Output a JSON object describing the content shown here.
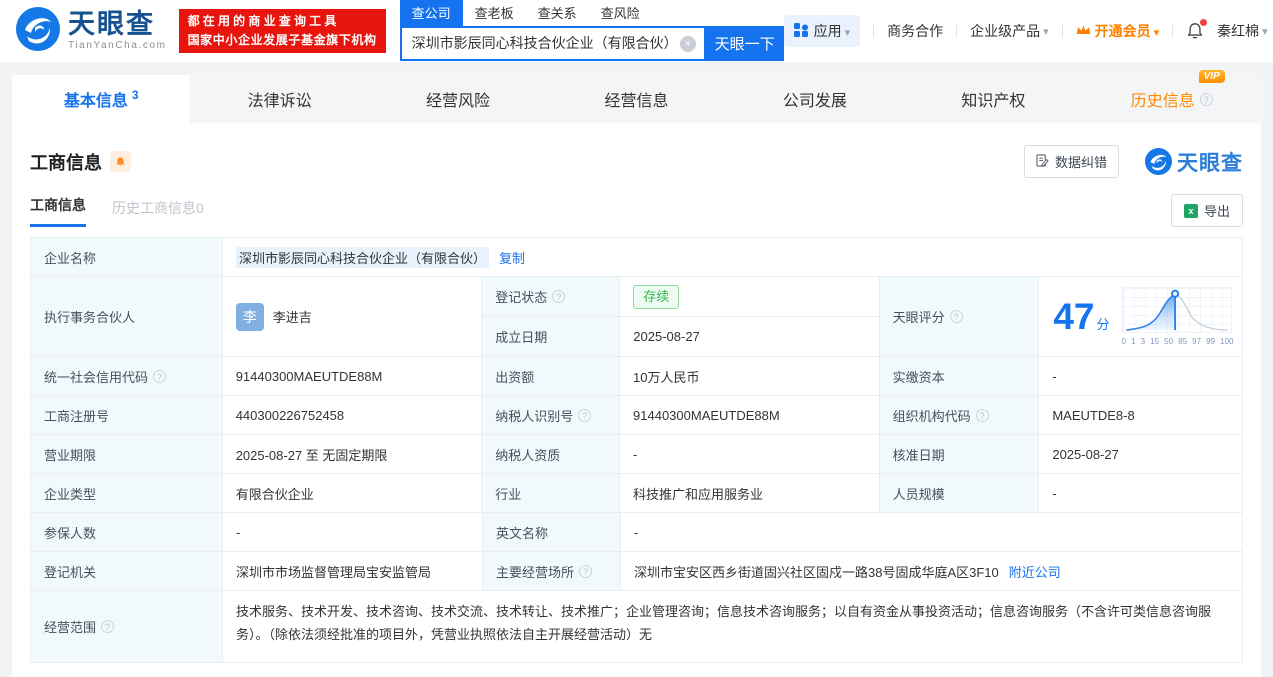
{
  "colors": {
    "accent": "#1673f0",
    "vip_orange": "#ff8a00",
    "status_green": "#35b558",
    "slogan_red": "#e8150f"
  },
  "header": {
    "logo": {
      "title": "天眼查",
      "subtitle": "TianYanCha.com"
    },
    "slogan": {
      "line1": "都在用的商业查询工具",
      "line2": "国家中小企业发展子基金旗下机构"
    },
    "search": {
      "tabs": [
        "查公司",
        "查老板",
        "查关系",
        "查风险"
      ],
      "value": "深圳市影辰同心科技合伙企业（有限合伙）",
      "button": "天眼一下"
    },
    "nav": {
      "apps": "应用",
      "biz": "商务合作",
      "enterprise": "企业级产品",
      "vip": "开通会员",
      "username": "秦红棉"
    }
  },
  "tabs": {
    "items": [
      "基本信息",
      "法律诉讼",
      "经营风险",
      "经营信息",
      "公司发展",
      "知识产权",
      "历史信息"
    ],
    "basic_count": "3",
    "vip_badge": "VIP"
  },
  "section": {
    "title": "工商信息",
    "correction": "数据纠错",
    "watermark": "天眼查",
    "subtabs": [
      "工商信息",
      "历史工商信息0"
    ],
    "export": "导出"
  },
  "table": {
    "company_name": {
      "label": "企业名称",
      "value": "深圳市影辰同心科技合伙企业（有限合伙）",
      "copy": "复制"
    },
    "partner": {
      "label": "执行事务合伙人",
      "avatar": "李",
      "name": "李进吉"
    },
    "reg_status": {
      "label": "登记状态",
      "value": "存续"
    },
    "establish_date": {
      "label": "成立日期",
      "value": "2025-08-27"
    },
    "score": {
      "label": "天眼评分",
      "value": "47",
      "unit": "分",
      "ticks": [
        "0",
        "1",
        "3",
        "15",
        "50",
        "85",
        "97",
        "99",
        "100"
      ]
    },
    "credit_code": {
      "label": "统一社会信用代码",
      "value": "91440300MAEUTDE88M"
    },
    "capital": {
      "label": "出资额",
      "value": "10万人民币"
    },
    "paid_capital": {
      "label": "实缴资本",
      "value": "-"
    },
    "reg_number": {
      "label": "工商注册号",
      "value": "440300226752458"
    },
    "taxpayer_id": {
      "label": "纳税人识别号",
      "value": "91440300MAEUTDE88M"
    },
    "org_code": {
      "label": "组织机构代码",
      "value": "MAEUTDE8-8"
    },
    "business_term": {
      "label": "营业期限",
      "value": "2025-08-27 至 无固定期限"
    },
    "taxpayer_quality": {
      "label": "纳税人资质",
      "value": "-"
    },
    "approval_date": {
      "label": "核准日期",
      "value": "2025-08-27"
    },
    "company_type": {
      "label": "企业类型",
      "value": "有限合伙企业"
    },
    "industry": {
      "label": "行业",
      "value": "科技推广和应用服务业"
    },
    "staff_size": {
      "label": "人员规模",
      "value": "-"
    },
    "insured_count": {
      "label": "参保人数",
      "value": "-"
    },
    "english_name": {
      "label": "英文名称",
      "value": "-"
    },
    "reg_authority": {
      "label": "登记机关",
      "value": "深圳市市场监督管理局宝安监管局"
    },
    "business_address": {
      "label": "主要经营场所",
      "value": "深圳市宝安区西乡街道固兴社区固戍一路38号固成华庭A区3F10",
      "link": "附近公司"
    },
    "business_scope": {
      "label": "经营范围",
      "value": "技术服务、技术开发、技术咨询、技术交流、技术转让、技术推广；企业管理咨询；信息技术咨询服务；以自有资金从事投资活动；信息咨询服务（不含许可类信息咨询服务）。（除依法须经批准的项目外，凭营业执照依法自主开展经营活动）无"
    }
  }
}
